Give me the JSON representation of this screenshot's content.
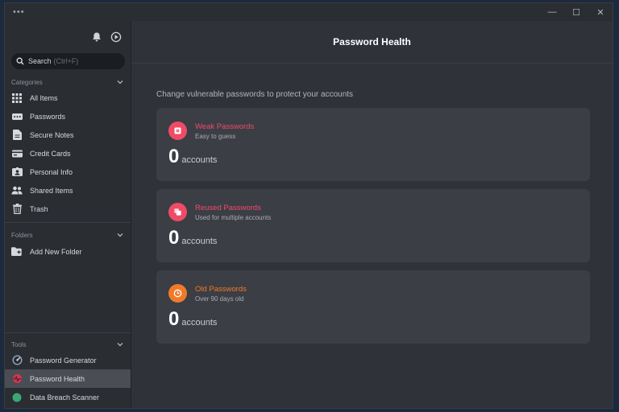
{
  "window": {
    "menu_dots": "•••",
    "minimize": "—",
    "maximize": "☐",
    "close": "✕"
  },
  "sidebar": {
    "search_label": "Search",
    "search_hint": "(Ctrl+F)",
    "categories_label": "Categories",
    "categories": [
      {
        "label": "All Items",
        "icon": "grid-icon"
      },
      {
        "label": "Passwords",
        "icon": "password-icon"
      },
      {
        "label": "Secure Notes",
        "icon": "note-icon"
      },
      {
        "label": "Credit Cards",
        "icon": "credit-card-icon"
      },
      {
        "label": "Personal Info",
        "icon": "id-card-icon"
      },
      {
        "label": "Shared Items",
        "icon": "shared-users-icon"
      },
      {
        "label": "Trash",
        "icon": "trash-icon"
      }
    ],
    "folders_label": "Folders",
    "add_folder": "Add New Folder",
    "tools_label": "Tools",
    "tools": [
      {
        "label": "Password Generator",
        "icon": "generator-icon"
      },
      {
        "label": "Password Health",
        "icon": "health-icon",
        "active": true
      },
      {
        "label": "Data Breach Scanner",
        "icon": "breach-scanner-icon"
      }
    ]
  },
  "main": {
    "title": "Password Health",
    "subtitle": "Change vulnerable passwords to protect your accounts",
    "cards": [
      {
        "title": "Weak Passwords",
        "desc": "Easy to guess",
        "count": "0",
        "unit": "accounts",
        "color": "#ef4b67"
      },
      {
        "title": "Reused Passwords",
        "desc": "Used for multiple accounts",
        "count": "0",
        "unit": "accounts",
        "color": "#ef4b67"
      },
      {
        "title": "Old Passwords",
        "desc": "Over 90 days old",
        "count": "0",
        "unit": "accounts",
        "color": "#f07a2a"
      }
    ]
  },
  "colors": {
    "active_nav": "#4a4d53",
    "weak": "#ef4b67",
    "reused": "#ef4b67",
    "old": "#f07a2a"
  }
}
